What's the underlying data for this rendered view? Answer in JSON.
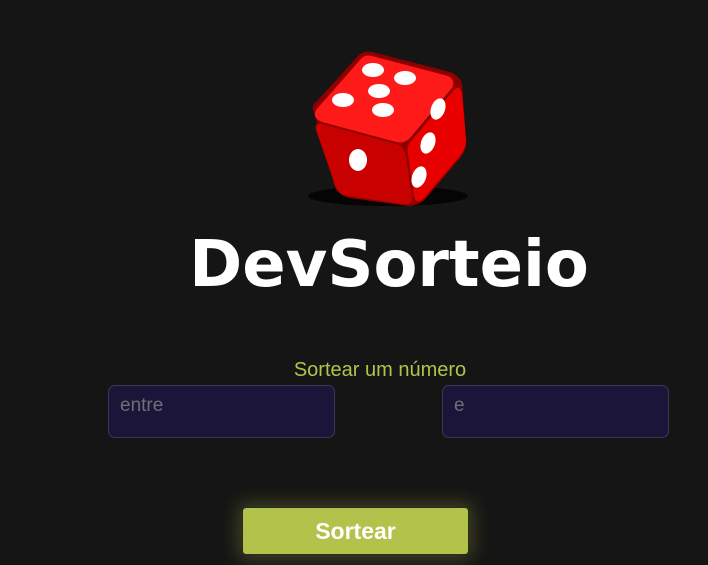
{
  "app": {
    "title": "DevSorteio"
  },
  "logo": {
    "icon": "dice-icon",
    "color": "#e3000f"
  },
  "form": {
    "heading": "Sortear um número",
    "min_placeholder": "entre",
    "max_placeholder": "e",
    "submit_label": "Sortear"
  },
  "colors": {
    "background": "#151515",
    "accent": "#b2c24a",
    "input_bg": "#1b1539"
  }
}
